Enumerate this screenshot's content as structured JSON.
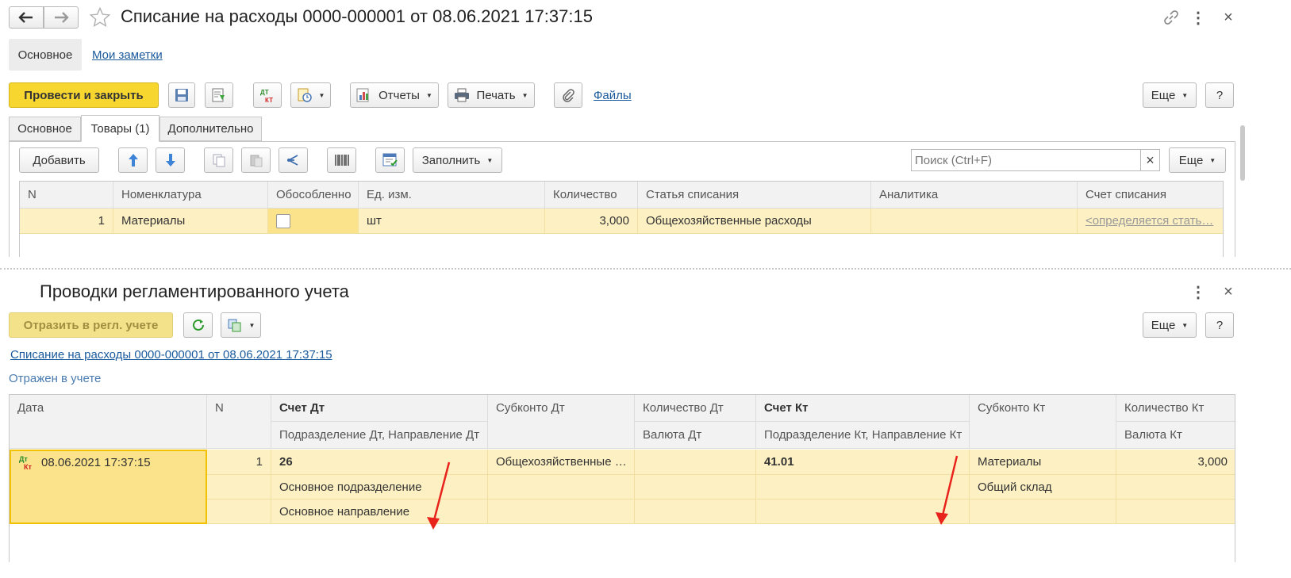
{
  "window": {
    "title": "Списание на расходы 0000-000001 от 08.06.2021 17:37:15",
    "nav_tabs": [
      "Основное",
      "Мои заметки"
    ]
  },
  "toolbar": {
    "post_close": "Провести и закрыть",
    "reports": "Отчеты",
    "print": "Печать",
    "files": "Файлы",
    "more": "Еще",
    "help": "?"
  },
  "doc_tabs": [
    "Основное",
    "Товары (1)",
    "Дополнительно"
  ],
  "goods": {
    "add": "Добавить",
    "fill": "Заполнить",
    "search_placeholder": "Поиск (Ctrl+F)",
    "search_clear": "×",
    "more": "Еще",
    "columns": [
      "N",
      "Номенклатура",
      "Обособленно",
      "Ед. изм.",
      "Количество",
      "Статья списания",
      "Аналитика",
      "Счет списания"
    ],
    "rows": [
      {
        "n": "1",
        "item": "Материалы",
        "separate": false,
        "unit": "шт",
        "qty": "3,000",
        "article": "Общехозяйственные расходы",
        "analytics": "",
        "account": "<определяется стать…"
      }
    ]
  },
  "postings": {
    "title": "Проводки регламентированного учета",
    "reflect": "Отразить в регл. учете",
    "more": "Еще",
    "help": "?",
    "doc_link": "Списание на расходы 0000-000001 от 08.06.2021 17:37:15",
    "status": "Отражен в учете",
    "header": {
      "date": "Дата",
      "n": "N",
      "acc_dt": "Счет Дт",
      "acc_dt_sub": "Подразделение Дт, Направление Дт",
      "subconto_dt": "Субконто Дт",
      "qty_dt": "Количество Дт",
      "qty_dt_sub": "Валюта Дт",
      "acc_kt": "Счет Кт",
      "acc_kt_sub": "Подразделение Кт, Направление Кт",
      "subconto_kt": "Субконто Кт",
      "qty_kt": "Количество Кт",
      "qty_kt_sub": "Валюта Кт"
    },
    "row": {
      "icon_dt": "Дт",
      "icon_kt": "Кт",
      "date": "08.06.2021 17:37:15",
      "n": "1",
      "acc_dt": "26",
      "dept_dt": "Основное подразделение",
      "dir_dt": "Основное направление",
      "subconto_dt": "Общехозяйственные …",
      "acc_kt": "41.01",
      "subconto_kt_1": "Материалы",
      "subconto_kt_2": "Общий склад",
      "qty_kt": "3,000"
    }
  },
  "colors": {
    "accent_yellow": "#f7d630",
    "row_highlight": "#fdf0c3",
    "selected_cell": "#fbe38c",
    "link": "#1a5a9c",
    "annotation_arrow": "#e8231b"
  }
}
